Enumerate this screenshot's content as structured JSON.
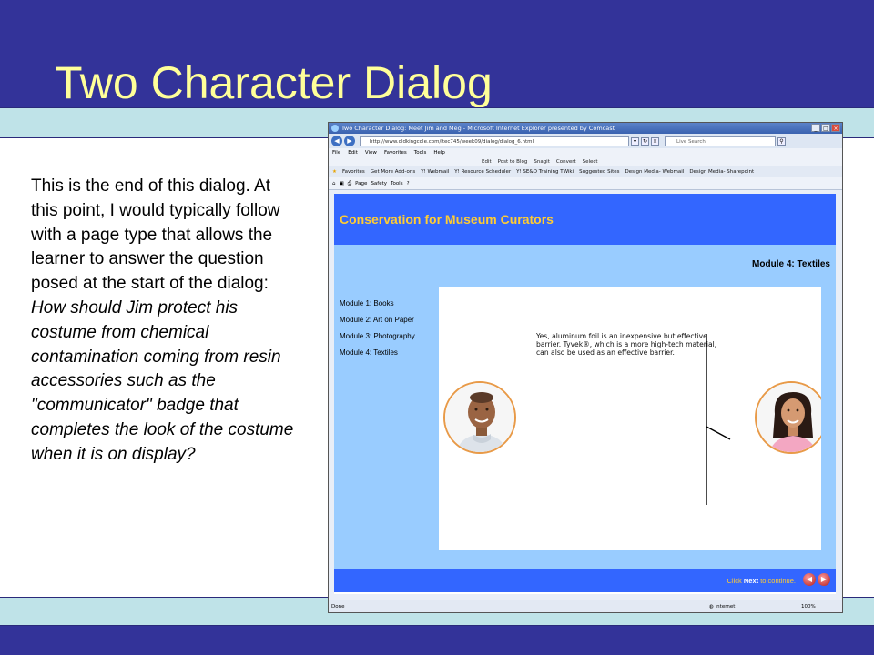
{
  "slide": {
    "title": "Two Character Dialog",
    "body_intro": "This is the end of this dialog. At this point, I would typically follow with a page type that allows the learner to answer the question posed at the start of the dialog: ",
    "body_question": "How should Jim protect his costume from chemical contamination coming from resin accessories such as the \"communicator\" badge that completes the look of the costume when it is on display?"
  },
  "browser": {
    "window_title": "Two Character Dialog: Meet Jim and Meg - Microsoft Internet Explorer presented by Comcast",
    "url": "http://www.oldkingcole.com/itec745/week09/dialog/dialog_6.html",
    "search_placeholder": "Live Search",
    "menu": [
      "File",
      "Edit",
      "View",
      "Favorites",
      "Tools",
      "Help"
    ],
    "toolbar_extra": [
      "Edit",
      "Post to Blog",
      "Snagit",
      "Convert",
      "Select"
    ],
    "favorites": [
      "Favorites",
      "Get More Add-ons",
      "Y! Webmail",
      "Y! Resource Scheduler",
      "Y! SE&O Training TWiki",
      "Suggested Sites",
      "Design Media- Webmail",
      "Design Media- Sharepoint"
    ],
    "command_bar": [
      "Page",
      "Safety",
      "Tools"
    ],
    "status": "Done",
    "zone": "Internet",
    "zoom": "100%"
  },
  "page": {
    "header_title": "Conservation for Museum Curators",
    "module_title": "Module 4: Textiles",
    "nav": [
      "Module 1: Books",
      "Module 2: Art on Paper",
      "Module 3: Photography",
      "Module 4: Textiles"
    ],
    "speech": "Yes, aluminum foil is an inexpensive but effective barrier. Tyvek®, which is a more high-tech material, can also be used as an effective barrier.",
    "continue_prefix": "Click ",
    "continue_next": "Next",
    "continue_suffix": " to continue."
  },
  "colors": {
    "slide_band": "#333399",
    "slide_strip": "#bfe3e8",
    "title_text": "#ffff99",
    "header_blue": "#3366ff",
    "light_blue": "#99ccff",
    "header_title": "#ffcc33",
    "portrait_ring": "#e89a48"
  },
  "icons": [
    "back-icon",
    "forward-icon",
    "refresh-icon",
    "stop-icon",
    "search-icon",
    "favorites-star-icon",
    "home-icon",
    "print-icon",
    "previous-arrow-icon",
    "next-arrow-icon",
    "globe-icon"
  ]
}
